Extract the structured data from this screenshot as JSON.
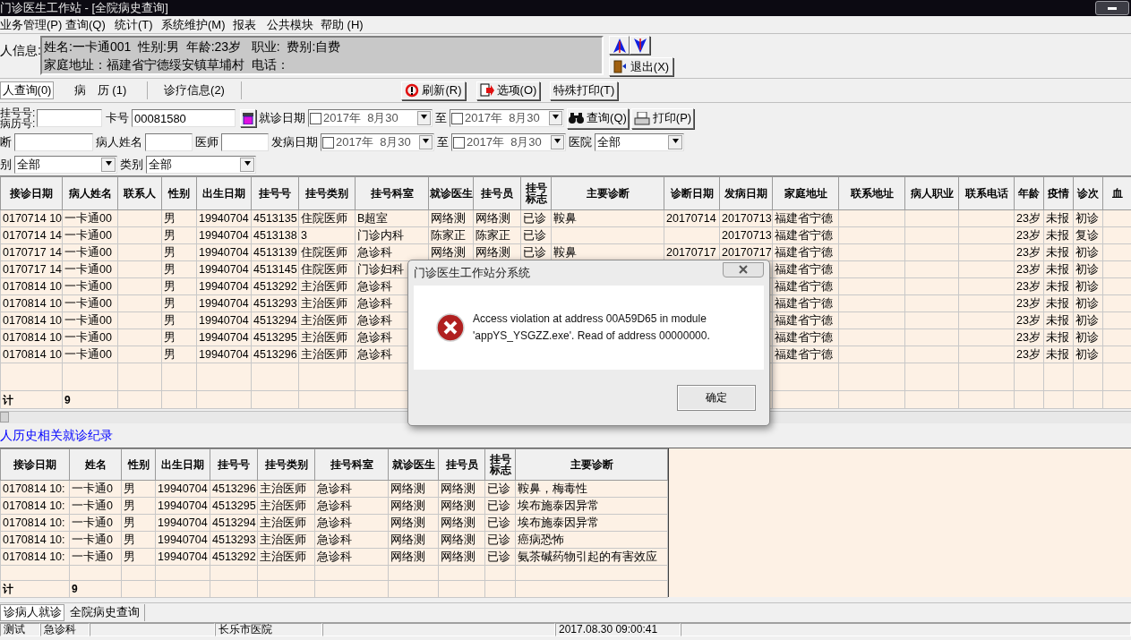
{
  "window": {
    "title": "门诊医生工作站 - [全院病史查询]"
  },
  "menu": [
    "业务管理(P)",
    "查询(Q)",
    "统计(T)",
    "系统维护(M)",
    "报表",
    "公共模块",
    "帮助 (H)"
  ],
  "patient_info": {
    "label": "人信息:",
    "line_1": "姓名:一卡通001  性别:男  年龄:23岁   职业:  费别:自费",
    "line_2": "家庭地址：福建省宁德绥安镇草埔村  电话："
  },
  "exit_button": "退出(X)",
  "tabs": [
    {
      "label": "人查询(0)",
      "selected": true
    },
    {
      "label": "病　历 (1)",
      "selected": false
    },
    {
      "label": "诊疗信息(2)",
      "selected": false
    }
  ],
  "toolbar_buttons": [
    "刷新(R)",
    "选项(O)",
    "特殊打印(T)"
  ],
  "search": {
    "reg_no_label": "挂号号:",
    "record_no_label": "病历号:",
    "card_label": "卡号",
    "card_no": "00081580",
    "visit_date_label": "就诊日期",
    "visit_from": {
      "checked": false,
      "value": "2017年  8月30"
    },
    "to_label_1": "至",
    "visit_to": {
      "checked": false,
      "value": "2017年  8月30"
    },
    "query_button": "查询(Q)",
    "print_button": "打印(P)",
    "diagnosis_label": "断",
    "patient_name_label": "病人姓名",
    "doctor_label": "医师",
    "onset_date_label": "发病日期",
    "onset_from": {
      "checked": false,
      "value": "2017年  8月30"
    },
    "to_label_2": "至",
    "onset_to": {
      "checked": false,
      "value": "2017年  8月30"
    },
    "hospital_label": "医院",
    "hospital": "全部",
    "category_1_label": "别",
    "category_1": "全部",
    "category_2_label": "类别",
    "category_2": "全部"
  },
  "upper_table": {
    "columns": [
      "接诊日期",
      "病人姓名",
      "联系人",
      "性别",
      "出生日期",
      "挂号号",
      "挂号类别",
      "挂号科室",
      "就诊医生",
      "挂号员",
      "挂号标志",
      "主要诊断",
      "诊断日期",
      "发病日期",
      "家庭地址",
      "联系地址",
      "病人职业",
      "联系电话",
      "年龄",
      "疫情",
      "诊次",
      "血"
    ],
    "rows": [
      [
        "0170714 10",
        "一卡通00",
        null,
        "男",
        "19940704",
        "4513135",
        "住院医师",
        "B超室",
        "网络测",
        "网络测",
        "已诊",
        "鞍鼻",
        "20170714",
        "20170713",
        "福建省宁德",
        null,
        null,
        null,
        "23岁",
        "未报",
        "初诊",
        null
      ],
      [
        "0170714 14",
        "一卡通00",
        null,
        "男",
        "19940704",
        "4513138",
        "3",
        "门诊内科",
        "陈家正",
        "陈家正",
        "已诊",
        null,
        null,
        "20170713",
        "福建省宁德",
        null,
        null,
        null,
        "23岁",
        "未报",
        "复诊",
        null
      ],
      [
        "0170717 14",
        "一卡通00",
        null,
        "男",
        "19940704",
        "4513139",
        "住院医师",
        "急诊科",
        "网络测",
        "网络测",
        "已诊",
        "鞍鼻",
        "20170717",
        "20170717",
        "福建省宁德",
        null,
        null,
        null,
        "23岁",
        "未报",
        "初诊",
        null
      ],
      [
        "0170717 14",
        "一卡通00",
        null,
        "男",
        "19940704",
        "4513145",
        "住院医师",
        "门诊妇科",
        null,
        null,
        null,
        null,
        null,
        null,
        "福建省宁德",
        null,
        null,
        null,
        "23岁",
        "未报",
        "初诊",
        null
      ],
      [
        "0170814 10",
        "一卡通00",
        null,
        "男",
        "19940704",
        "4513292",
        "主治医师",
        "急诊科",
        null,
        null,
        null,
        null,
        null,
        null,
        "福建省宁德",
        null,
        null,
        null,
        "23岁",
        "未报",
        "初诊",
        null
      ],
      [
        "0170814 10",
        "一卡通00",
        null,
        "男",
        "19940704",
        "4513293",
        "主治医师",
        "急诊科",
        null,
        null,
        null,
        null,
        null,
        null,
        "福建省宁德",
        null,
        null,
        null,
        "23岁",
        "未报",
        "初诊",
        null
      ],
      [
        "0170814 10",
        "一卡通00",
        null,
        "男",
        "19940704",
        "4513294",
        "主治医师",
        "急诊科",
        null,
        null,
        null,
        null,
        null,
        null,
        "福建省宁德",
        null,
        null,
        null,
        "23岁",
        "未报",
        "初诊",
        null
      ],
      [
        "0170814 10",
        "一卡通00",
        null,
        "男",
        "19940704",
        "4513295",
        "主治医师",
        "急诊科",
        null,
        null,
        null,
        null,
        null,
        null,
        "福建省宁德",
        null,
        null,
        null,
        "23岁",
        "未报",
        "初诊",
        null
      ],
      [
        "0170814 10",
        "一卡通00",
        null,
        "男",
        "19940704",
        "4513296",
        "主治医师",
        "急诊科",
        null,
        null,
        null,
        null,
        null,
        null,
        "福建省宁德",
        null,
        null,
        null,
        "23岁",
        "未报",
        "初诊",
        null
      ]
    ],
    "total": {
      "label": "计",
      "count": "9"
    }
  },
  "history_label": "人历史相关就诊纪录",
  "lower_table": {
    "columns": [
      "接诊日期",
      "姓名",
      "性别",
      "出生日期",
      "挂号号",
      "挂号类别",
      "挂号科室",
      "就诊医生",
      "挂号员",
      "挂号标志",
      "主要诊断"
    ],
    "rows": [
      [
        "0170814 10:",
        "一卡通0",
        "男",
        "19940704",
        "4513296",
        "主治医师",
        "急诊科",
        "网络测",
        "网络测",
        "已诊",
        "鞍鼻，梅毒性"
      ],
      [
        "0170814 10:",
        "一卡通0",
        "男",
        "19940704",
        "4513295",
        "主治医师",
        "急诊科",
        "网络测",
        "网络测",
        "已诊",
        "埃布施泰因异常"
      ],
      [
        "0170814 10:",
        "一卡通0",
        "男",
        "19940704",
        "4513294",
        "主治医师",
        "急诊科",
        "网络测",
        "网络测",
        "已诊",
        "埃布施泰因异常"
      ],
      [
        "0170814 10:",
        "一卡通0",
        "男",
        "19940704",
        "4513293",
        "主治医师",
        "急诊科",
        "网络测",
        "网络测",
        "已诊",
        "癌病恐怖"
      ],
      [
        "0170814 10:",
        "一卡通0",
        "男",
        "19940704",
        "4513292",
        "主治医师",
        "急诊科",
        "网络测",
        "网络测",
        "已诊",
        "氨茶碱药物引起的有害效应"
      ]
    ],
    "total": {
      "label": "计",
      "count": "9"
    }
  },
  "bottom_tabs": [
    {
      "label": "诊病人就诊",
      "selected": true
    },
    {
      "label": "全院病史查询",
      "selected": false
    }
  ],
  "status_bar": [
    "测试",
    "急诊科",
    "长乐市医院",
    "2017.08.30 09:00:41"
  ],
  "dialog": {
    "title": "门诊医生工作站分系统",
    "message": "Access violation at address 00A59D65 in module 'appYS_YSGZZ.exe'. Read of address 00000000.",
    "ok_button": "确定"
  }
}
